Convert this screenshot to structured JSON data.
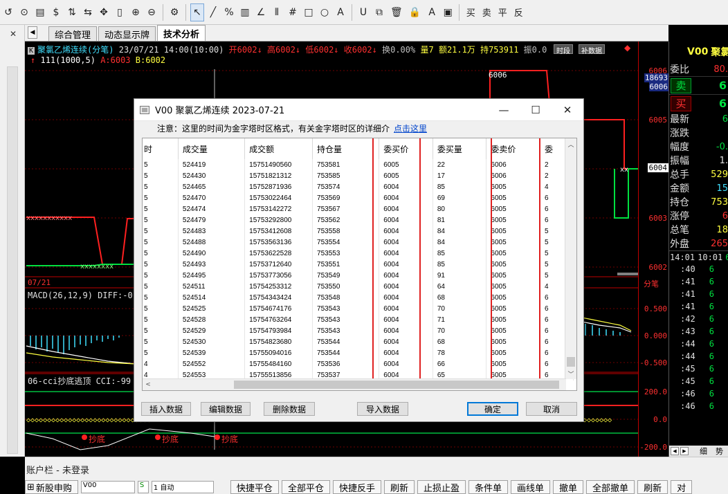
{
  "toolbar": {
    "items": [
      "↺",
      "⊙",
      "▤",
      "$",
      "⇅",
      "⇆",
      "✥",
      "▯",
      "⊕",
      "⊖",
      "⚙",
      "↖",
      "╱",
      "%",
      "▥",
      "∠",
      "⫴",
      "#",
      "□",
      "○",
      "A",
      "U",
      "⧉",
      "🗑",
      "🔒",
      "A",
      "▣"
    ],
    "text_items": [
      "买",
      "卖",
      "平",
      "反"
    ]
  },
  "tabs": [
    "综合管理",
    "动态显示牌",
    "技术分析"
  ],
  "chart": {
    "info": {
      "name": "聚氯乙烯连续(分笔)",
      "datetime": "23/07/21 14:00(10:00)",
      "open": "开6002↓",
      "high": "高6002↓",
      "low": "低6002↓",
      "close": "收6002↓",
      "turnover": "换0.00%",
      "volume": "量7",
      "amount": "额21.1万",
      "position": "持753911",
      "amplitude": "振0.0",
      "btn_shijian": "时段",
      "btn_buchong": "补数据"
    },
    "sub_info": {
      "line": "111(1000,5)",
      "a": "A:6003",
      "b": "B:6002"
    },
    "price_labels": [
      "6006",
      "6005",
      "6004",
      "6003",
      "6002"
    ],
    "price_box_top": "18693",
    "price_box_bottom": "6006",
    "current_price": "6004",
    "line_label": "6006",
    "date_label": "07/21",
    "fen_label": "分笔",
    "macd_label": "MACD(26,12,9) DIFF:-0.",
    "macd_axis": [
      "0.500",
      "0.000",
      "-0.500"
    ],
    "cci_label": "06-cci抄底逃顶 CCI:-99",
    "cci_axis": [
      "200.0",
      "0.0",
      "-200.0"
    ],
    "dibot_label": "抄底"
  },
  "right_panel": {
    "code": "V00",
    "name": "聚氯",
    "rows": [
      {
        "label": "委比",
        "value": "80."
      },
      {
        "label": "最新",
        "value": "6"
      },
      {
        "label": "涨跌",
        "value": ""
      },
      {
        "label": "幅度",
        "value": "-0."
      },
      {
        "label": "振幅",
        "value": "1."
      },
      {
        "label": "总手",
        "value": "529"
      },
      {
        "label": "金额",
        "value": "15"
      },
      {
        "label": "持仓",
        "value": "753"
      },
      {
        "label": "涨停",
        "value": "6"
      },
      {
        "label": "总笔",
        "value": "18"
      },
      {
        "label": "外盘",
        "value": "265"
      }
    ],
    "sell_label": "卖",
    "sell_value": "6",
    "buy_label": "买",
    "buy_value": "6",
    "tick_head": {
      "t1": "14:01",
      "t2": "10:01",
      "v": "6"
    },
    "ticks": [
      ":40",
      ":41",
      ":41",
      ":41",
      ":42",
      ":43",
      ":44",
      ":44",
      ":45",
      ":45",
      ":46",
      ":46"
    ],
    "tick_value": "6",
    "bottom": {
      "a": "细",
      "b": "势"
    }
  },
  "account": {
    "title": "账户栏 - 未登录",
    "new_stock": "新股申购",
    "input_value": "V00",
    "s_label": "S",
    "auto_label": "1 自动",
    "buttons": [
      "快捷平仓",
      "全部平仓",
      "快捷反手",
      "刷新",
      "止损止盈",
      "条件单",
      "画线单",
      "撤单",
      "全部撤单",
      "刷新",
      "对"
    ]
  },
  "dialog": {
    "title": "V00 聚氯乙烯连续 2023-07-21",
    "notice": "注意：这里的时间为金字塔时区格式，有关金字塔时区的详细介",
    "notice_link": "点击这里",
    "columns": [
      "时",
      "成交量",
      "成交额",
      "持仓量",
      "委买价",
      "委买量",
      "委卖价",
      "委"
    ],
    "rows": [
      [
        "5",
        "524419",
        "15751490560",
        "753581",
        "6005",
        "22",
        "6006",
        "2"
      ],
      [
        "5",
        "524430",
        "15751821312",
        "753585",
        "6005",
        "17",
        "6006",
        "2"
      ],
      [
        "5",
        "524465",
        "15752871936",
        "753574",
        "6004",
        "85",
        "6005",
        "4"
      ],
      [
        "5",
        "524470",
        "15753022464",
        "753569",
        "6004",
        "69",
        "6005",
        "6"
      ],
      [
        "5",
        "524474",
        "15753142272",
        "753567",
        "6004",
        "80",
        "6005",
        "6"
      ],
      [
        "5",
        "524479",
        "15753292800",
        "753562",
        "6004",
        "81",
        "6005",
        "6"
      ],
      [
        "5",
        "524483",
        "15753412608",
        "753558",
        "6004",
        "84",
        "6005",
        "5"
      ],
      [
        "5",
        "524488",
        "15753563136",
        "753554",
        "6004",
        "84",
        "6005",
        "5"
      ],
      [
        "5",
        "524490",
        "15753622528",
        "753553",
        "6004",
        "85",
        "6005",
        "5"
      ],
      [
        "5",
        "524493",
        "15753712640",
        "753551",
        "6004",
        "85",
        "6005",
        "5"
      ],
      [
        "5",
        "524495",
        "15753773056",
        "753549",
        "6004",
        "91",
        "6005",
        "5"
      ],
      [
        "5",
        "524511",
        "15754253312",
        "753550",
        "6004",
        "64",
        "6005",
        "4"
      ],
      [
        "5",
        "524514",
        "15754343424",
        "753548",
        "6004",
        "68",
        "6005",
        "6"
      ],
      [
        "5",
        "524525",
        "15754674176",
        "753543",
        "6004",
        "70",
        "6005",
        "6"
      ],
      [
        "5",
        "524528",
        "15754763264",
        "753543",
        "6004",
        "71",
        "6005",
        "6"
      ],
      [
        "5",
        "524529",
        "15754793984",
        "753543",
        "6004",
        "70",
        "6005",
        "6"
      ],
      [
        "5",
        "524530",
        "15754823680",
        "753544",
        "6004",
        "68",
        "6005",
        "6"
      ],
      [
        "5",
        "524539",
        "15755094016",
        "753544",
        "6004",
        "78",
        "6005",
        "6"
      ],
      [
        "4",
        "524552",
        "15755484160",
        "753536",
        "6004",
        "66",
        "6005",
        "6"
      ],
      [
        "4",
        "524553",
        "15755513856",
        "753537",
        "6004",
        "65",
        "6005",
        "6"
      ]
    ],
    "buttons": {
      "insert": "插入数据",
      "edit": "编辑数据",
      "delete": "删除数据",
      "import": "导入数据",
      "ok": "确定",
      "cancel": "取消"
    }
  }
}
